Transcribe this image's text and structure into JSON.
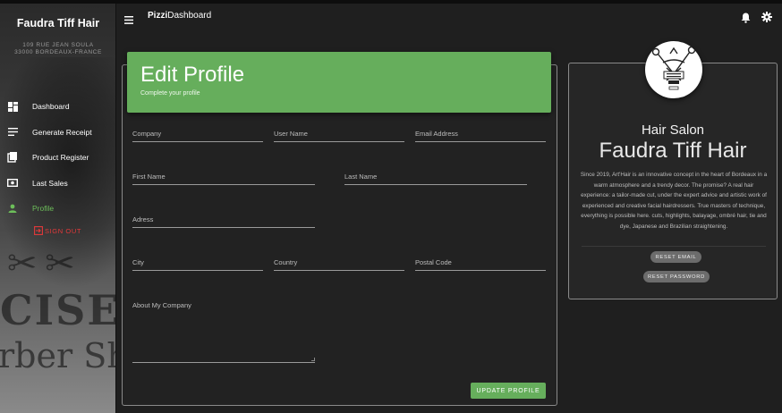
{
  "sidebar": {
    "brand": "Faudra Tiff Hair",
    "address_line1": "109 RUE JEAN SOULA",
    "address_line2": "33000 BORDEAUX-FRANCE",
    "nav": [
      {
        "label": "Dashboard",
        "icon": "dashboard-icon"
      },
      {
        "label": "Generate Receipt",
        "icon": "receipt-icon"
      },
      {
        "label": "Product Register",
        "icon": "product-icon"
      },
      {
        "label": "Last Sales",
        "icon": "sales-icon"
      },
      {
        "label": "Profile",
        "icon": "person-icon"
      }
    ],
    "signout": "SIGN OUT",
    "bg_text_1": "CISE",
    "bg_text_2": "rber Sh"
  },
  "topbar": {
    "title_bold": "Pizzi",
    "title_rest": "Dashboard"
  },
  "edit": {
    "title": "Edit Profile",
    "subtitle": "Complete your profile",
    "fields": {
      "company": {
        "label": "Company",
        "value": ""
      },
      "username": {
        "label": "User Name",
        "value": ""
      },
      "email": {
        "label": "Email Address",
        "value": ""
      },
      "first_name": {
        "label": "First Name",
        "value": ""
      },
      "last_name": {
        "label": "Last Name",
        "value": ""
      },
      "address": {
        "label": "Adress",
        "value": ""
      },
      "city": {
        "label": "City",
        "value": ""
      },
      "country": {
        "label": "Country",
        "value": ""
      },
      "postal": {
        "label": "Postal Code",
        "value": ""
      },
      "about": {
        "label": "About My Company",
        "value": ""
      }
    },
    "submit": "UPDATE PROFILE"
  },
  "profile": {
    "category": "Hair Salon",
    "name": "Faudra Tiff Hair",
    "description": "Since 2019, Art'Hair is an innovative concept in the heart of Bordeaux in a warm atmosphere and a trendy decor. The promise? A real hair experience: a tailor-made cut, under the expert advice and artistic work of experienced and creative facial hairdressers. True masters of technique, everything is possible here. cuts, highlights, balayage, ombré hair, tie and dye, Japanese and Brazilian straightening.",
    "reset_email": "RESET EMAIL",
    "reset_password": "RESET PASSWORD"
  },
  "colors": {
    "accent": "#66ae5c",
    "active_nav": "#6dbf5a",
    "signout": "#e5393a",
    "background": "#1f1f1f"
  }
}
